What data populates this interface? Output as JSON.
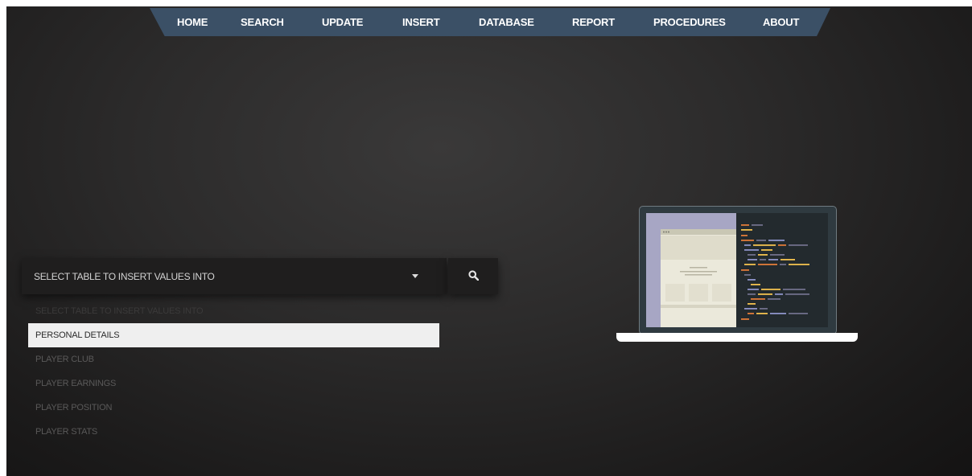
{
  "nav": {
    "items": [
      {
        "label": "HOME"
      },
      {
        "label": "SEARCH"
      },
      {
        "label": "UPDATE"
      },
      {
        "label": "INSERT"
      },
      {
        "label": "DATABASE"
      },
      {
        "label": "REPORT"
      },
      {
        "label": "PROCEDURES"
      },
      {
        "label": "ABOUT"
      }
    ]
  },
  "select": {
    "value": "SELECT TABLE TO INSERT VALUES INTO",
    "options": [
      {
        "label": "SELECT TABLE TO INSERT VALUES INTO",
        "disabled": true
      },
      {
        "label": "PERSONAL DETAILS",
        "selected": true
      },
      {
        "label": "PLAYER CLUB"
      },
      {
        "label": "PLAYER EARNINGS"
      },
      {
        "label": "PLAYER POSITION"
      },
      {
        "label": "PLAYER STATS"
      }
    ]
  },
  "icons": {
    "dropdown": "caret-down-icon",
    "search": "search-icon",
    "illustration": "laptop-code-illustration"
  },
  "colors": {
    "nav_bg": "#3b5066",
    "page_bg": "#2c2b2b",
    "selected_option_bg": "#efefef"
  }
}
